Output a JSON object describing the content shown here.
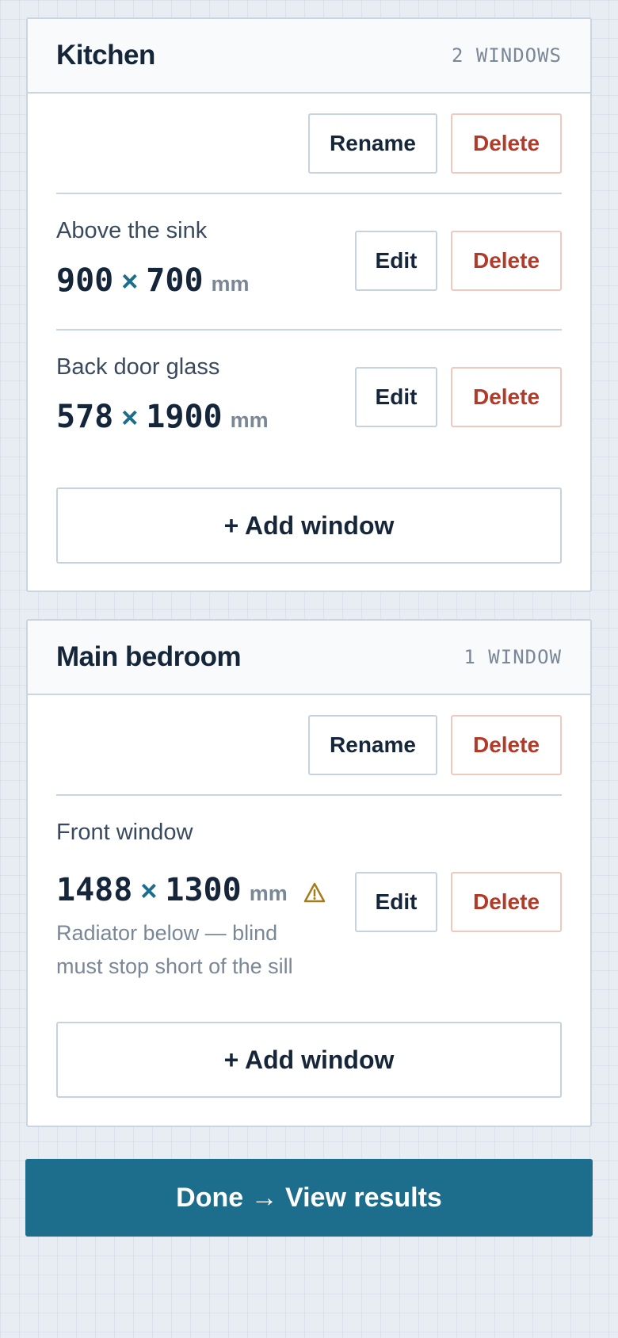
{
  "rooms": [
    {
      "name": "Kitchen",
      "count": "2 WINDOWS",
      "rename_label": "Rename",
      "delete_label": "Delete",
      "windows": [
        {
          "name": "Above the sink",
          "width": "900",
          "height": "700",
          "unit": "mm",
          "edit_label": "Edit",
          "delete_label": "Delete"
        },
        {
          "name": "Back door glass",
          "width": "578",
          "height": "1900",
          "unit": "mm",
          "edit_label": "Edit",
          "delete_label": "Delete"
        }
      ],
      "add_label": "+ Add window"
    },
    {
      "name": "Main bedroom",
      "count": "1 WINDOW",
      "rename_label": "Rename",
      "delete_label": "Delete",
      "windows": [
        {
          "name": "Front window",
          "width": "1488",
          "height": "1300",
          "unit": "mm",
          "note": "Radiator below — blind must stop short of the sill",
          "warning_icon": "warning-triangle-icon",
          "edit_label": "Edit",
          "delete_label": "Delete"
        }
      ],
      "add_label": "+ Add window"
    }
  ],
  "times_symbol": "×",
  "done_label": "Done → View results",
  "colors": {
    "accent": "#1c6e8c",
    "danger": "#b23a28",
    "warning": "#a67c1a"
  }
}
